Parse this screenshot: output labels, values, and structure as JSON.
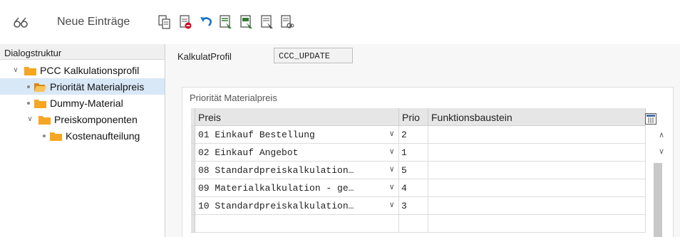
{
  "toolbar": {
    "title": "Neue Einträge",
    "icons": [
      "glasses-icon",
      "copy-icon",
      "delete-icon",
      "undo-icon",
      "select-all-icon",
      "select-block-icon",
      "deselect-icon",
      "details-icon"
    ]
  },
  "dialog": {
    "header": "Dialogstruktur",
    "tree": [
      {
        "label": "PCC Kalkulationsprofil",
        "level": 0,
        "expanded": true
      },
      {
        "label": "Priorität Materialpreis",
        "level": 1,
        "selected": true
      },
      {
        "label": "Dummy-Material",
        "level": 1
      },
      {
        "label": "Preiskomponenten",
        "level": 1,
        "expanded": true
      },
      {
        "label": "Kostenaufteilung",
        "level": 2
      }
    ]
  },
  "form": {
    "kalkulat_label": "KalkulatProfil",
    "kalkulat_value": "CCC_UPDATE"
  },
  "table": {
    "group_title": "Priorität Materialpreis",
    "columns": [
      "Preis",
      "Prio",
      "Funktionsbaustein"
    ],
    "rows": [
      {
        "preis": "01 Einkauf Bestellung",
        "prio": "2",
        "fb": ""
      },
      {
        "preis": "02 Einkauf Angebot",
        "prio": "1",
        "fb": ""
      },
      {
        "preis": "08 Standardpreiskalkulation…",
        "prio": "5",
        "fb": ""
      },
      {
        "preis": "09 Materialkalkulation - ge…",
        "prio": "4",
        "fb": ""
      },
      {
        "preis": "10 Standardpreiskalkulation…",
        "prio": "3",
        "fb": ""
      }
    ]
  },
  "colors": {
    "folder": "#f5a623",
    "selection": "#d9e8f7",
    "header_bg": "#e6e6e6"
  }
}
